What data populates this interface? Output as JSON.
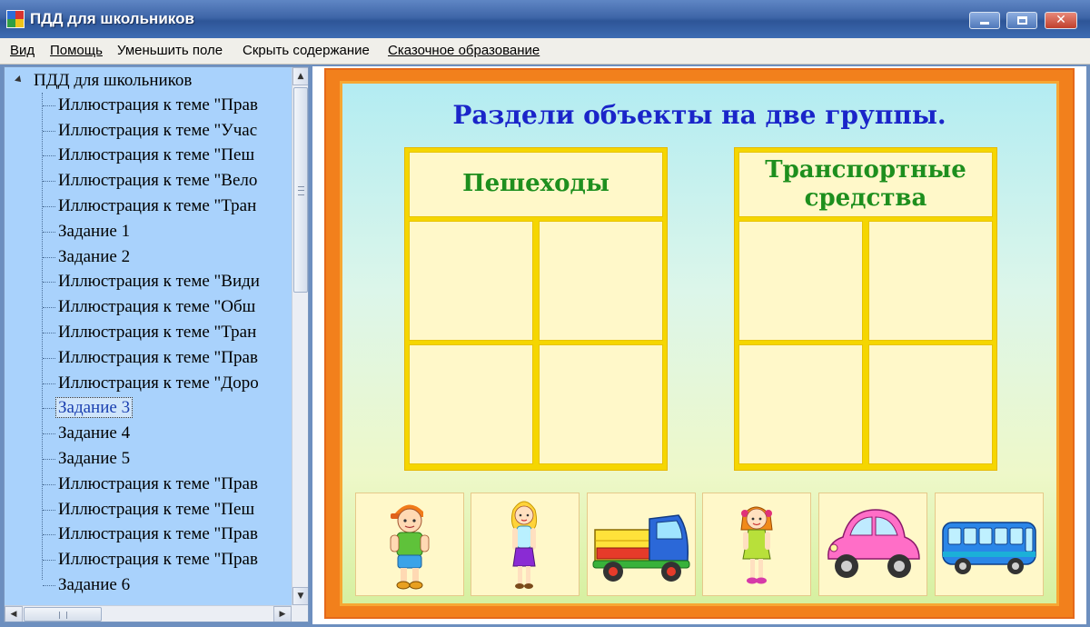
{
  "window": {
    "title": "ПДД для школьников"
  },
  "menu": [
    {
      "label": "Вид"
    },
    {
      "label": "Помощь"
    },
    {
      "label": "Уменьшить поле"
    },
    {
      "label": "Скрыть содержание"
    },
    {
      "label": "Сказочное образование"
    }
  ],
  "tree": {
    "root": "ПДД для школьников",
    "items": [
      "Иллюстрация к теме \"Прав",
      "Иллюстрация к теме \"Учас",
      "Иллюстрация к теме \"Пеш",
      "Иллюстрация к теме \"Вело",
      "Иллюстрация к теме \"Тран",
      "Задание 1",
      "Задание 2",
      "Иллюстрация к теме \"Види",
      "Иллюстрация к теме \"Обш",
      "Иллюстрация к теме \"Тран",
      "Иллюстрация к теме \"Прав",
      "Иллюстрация к теме \"Доро",
      "Задание 3",
      "Задание 4",
      "Задание 5",
      "Иллюстрация к теме \"Прав",
      "Иллюстрация к теме \"Пеш",
      "Иллюстрация к теме \"Прав",
      "Иллюстрация к теме \"Прав",
      "Задание 6"
    ],
    "selected_item": "Задание 3"
  },
  "task": {
    "title": "Раздели объекты на две группы.",
    "group_left": "Пешеходы",
    "group_right_line1": "Транспортные",
    "group_right_line2": "средства"
  },
  "cards": [
    {
      "icon": "boy-figure-icon",
      "kind": "pedestrian"
    },
    {
      "icon": "woman-figure-icon",
      "kind": "pedestrian"
    },
    {
      "icon": "truck-icon",
      "kind": "vehicle"
    },
    {
      "icon": "girl-figure-icon",
      "kind": "pedestrian"
    },
    {
      "icon": "car-icon",
      "kind": "vehicle"
    },
    {
      "icon": "bus-icon",
      "kind": "vehicle"
    }
  ],
  "colors": {
    "title_text": "#1a25c9",
    "group_text": "#1e8f1e",
    "frame_orange": "#f2801c",
    "group_yellow": "#f5d600",
    "tree_background": "#a9d2fc"
  }
}
